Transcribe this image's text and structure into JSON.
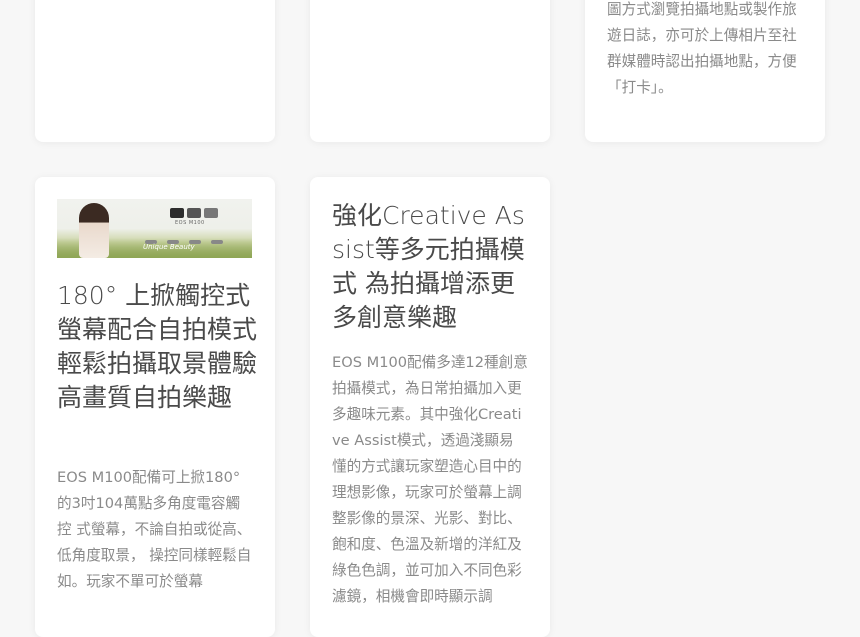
{
  "cards": {
    "a": {},
    "b": {},
    "c": {
      "body": "圖方式瀏覽拍攝地點或製作旅遊日誌，亦可於上傳相片至社群媒體時認出拍攝地點，方便「打卡」。"
    },
    "d": {
      "banner": {
        "brand": "EOS M100",
        "slogan": "Unique Beauty"
      },
      "title": "180° 上掀觸控式螢幕配合自拍模式 輕鬆拍攝取景體驗高畫質自拍樂趣",
      "body": "EOS M100配備可上掀180°的3吋104萬點多角度電容觸控 式螢幕，不論自拍或從高、低角度取景， 操控同樣輕鬆自如。玩家不單可於螢幕"
    },
    "e": {
      "title": "強化Creative Assist等多元拍攝模式 為拍攝增添更多創意樂趣",
      "body": "EOS M100配備多達12種創意拍攝模式，為日常拍攝加入更多趣味元素。其中強化Creative Assist模式，透過淺顯易懂的方式讓玩家塑造心目中的理想影像，玩家可於螢幕上調整影像的景深、光影、對比、飽和度、色溫及新增的洋紅及綠色色調，並可加入不同色彩濾鏡，相機會即時顯示調"
    }
  }
}
